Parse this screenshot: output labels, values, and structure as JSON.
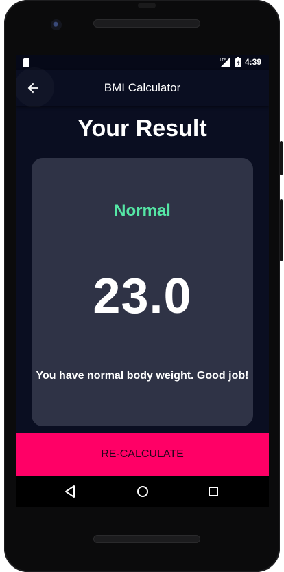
{
  "status_bar": {
    "time": "4:39",
    "icons": [
      "sd-card-icon",
      "lte-signal-icon",
      "battery-icon"
    ]
  },
  "app_bar": {
    "title": "BMI Calculator",
    "back_icon": "arrow-left-icon"
  },
  "result": {
    "heading": "Your Result",
    "status": "Normal",
    "bmi": "23.0",
    "interpretation": "You have normal body weight. Good job!"
  },
  "actions": {
    "recalculate_label": "RE-CALCULATE"
  },
  "nav_bar": {
    "icons": [
      "nav-back-icon",
      "nav-home-icon",
      "nav-recents-icon"
    ]
  },
  "colors": {
    "background": "#0a0e21",
    "card": "#2f3346",
    "status_normal": "#55e6a5",
    "accent": "#ff0066",
    "text": "#ffffff"
  }
}
